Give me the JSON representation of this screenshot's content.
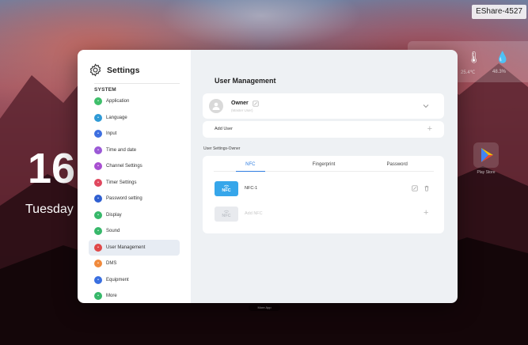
{
  "desktop": {
    "device_badge": "EShare-4527",
    "clock_time": "16",
    "clock_day": "Tuesday",
    "weather": [
      {
        "icon": "thermometer-icon",
        "text": "25.4℃"
      },
      {
        "icon": "humidity-drop-icon",
        "text": "48.3%"
      }
    ],
    "app": {
      "icon": "play-store-icon",
      "label": "Play Store"
    },
    "dock_label": "More App"
  },
  "settings": {
    "title": "Settings",
    "section": "SYSTEM",
    "items": [
      {
        "label": "Application",
        "icon": "grid-icon",
        "color": "#3fbf6b"
      },
      {
        "label": "Language",
        "icon": "globe-icon",
        "color": "#2f9ad6"
      },
      {
        "label": "Input",
        "icon": "input-icon",
        "color": "#3d6fe0"
      },
      {
        "label": "Time and date",
        "icon": "clock-icon",
        "color": "#9b59d6"
      },
      {
        "label": "Channel Settings",
        "icon": "channel-icon",
        "color": "#a84fd1"
      },
      {
        "label": "Timer Settings",
        "icon": "timer-icon",
        "color": "#e0485f"
      },
      {
        "label": "Password setting",
        "icon": "lock-icon",
        "color": "#2f5fd1"
      },
      {
        "label": "Display",
        "icon": "display-icon",
        "color": "#37b86a"
      },
      {
        "label": "Sound",
        "icon": "sound-icon",
        "color": "#37b86a"
      },
      {
        "label": "User Management",
        "icon": "user-icon",
        "color": "#e04848"
      },
      {
        "label": "DMS",
        "icon": "dms-icon",
        "color": "#f08a3c"
      },
      {
        "label": "Equipment",
        "icon": "equipment-icon",
        "color": "#3a6fe0"
      },
      {
        "label": "More",
        "icon": "more-icon",
        "color": "#37b86a"
      }
    ],
    "active_index": 9
  },
  "user_management": {
    "title": "User Management",
    "owner_name": "Owner",
    "owner_subtitle": "(Master User)",
    "add_user_label": "Add User",
    "user_settings_label": "User Settings-Owner",
    "tabs": [
      "NFC",
      "Fingerprint",
      "Password"
    ],
    "active_tab": 0,
    "nfc_items": [
      {
        "label": "NFC-1",
        "tile_text": "NFC"
      }
    ],
    "add_nfc": {
      "label": "Add NFC",
      "tile_text": "NFC"
    },
    "colors": {
      "accent": "#2f7de1",
      "nfc_tile": "#36a6ea",
      "nfc_tile_disabled": "#e8eaee"
    }
  }
}
